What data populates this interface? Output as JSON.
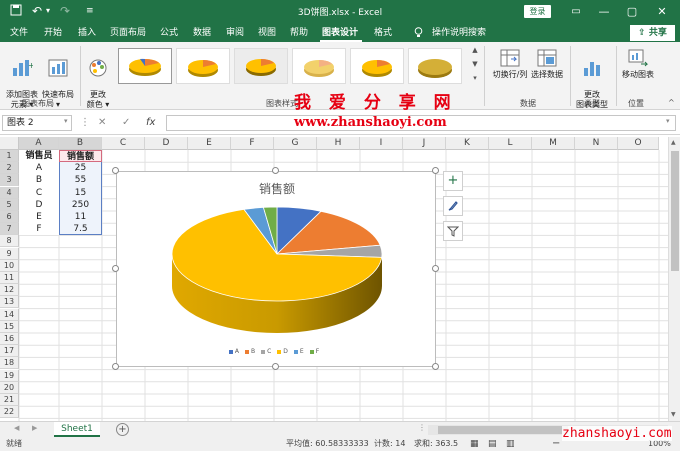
{
  "titlebar": {
    "title": "3D饼图.xlsx  -  Excel",
    "login": "登录",
    "minimize": "—",
    "restore": "▢",
    "close": "✕",
    "save_icon": "save-icon",
    "undo_icon": "undo-icon",
    "redo_icon": "redo-icon"
  },
  "tabs": [
    "文件",
    "开始",
    "插入",
    "页面布局",
    "公式",
    "数据",
    "审阅",
    "视图",
    "帮助",
    "图表设计",
    "格式"
  ],
  "active_tab": "图表设计",
  "tell_me": "操作说明搜索",
  "share": "共享",
  "ribbon": {
    "add_element": "添加图表\n元素 ▾",
    "quick_layout": "快速布局\n▾",
    "group_layout": "图表布局",
    "change_color": "更改\n颜色 ▾",
    "group_style": "图表样式",
    "switch_row_col": "切换行/列",
    "select_data": "选择数据",
    "group_data": "数据",
    "change_type": "更改\n图表类型",
    "group_type": "类型",
    "move_chart": "移动图表",
    "group_location": "位置"
  },
  "formula_bar": {
    "name_box": "图表 2",
    "cancel": "✕",
    "enter": "✓",
    "fx": "fx"
  },
  "columns": [
    "A",
    "B",
    "C",
    "D",
    "E",
    "F",
    "G",
    "H",
    "I",
    "J",
    "K",
    "L",
    "M",
    "N",
    "O"
  ],
  "rows": [
    "1",
    "2",
    "3",
    "4",
    "5",
    "6",
    "7",
    "8",
    "9",
    "10",
    "11",
    "12",
    "13",
    "14",
    "15",
    "16",
    "17",
    "18",
    "19",
    "20",
    "21",
    "22"
  ],
  "table": {
    "headers": [
      "销售员",
      "销售额"
    ],
    "rows": [
      [
        "A",
        "25"
      ],
      [
        "B",
        "55"
      ],
      [
        "C",
        "15"
      ],
      [
        "D",
        "250"
      ],
      [
        "E",
        "11"
      ],
      [
        "F",
        "7.5"
      ]
    ]
  },
  "chart_data": {
    "type": "pie",
    "title": "销售额",
    "categories": [
      "A",
      "B",
      "C",
      "D",
      "E",
      "F"
    ],
    "values": [
      25,
      55,
      15,
      250,
      11,
      7.5
    ],
    "colors": [
      "#4472c4",
      "#ed7d31",
      "#a5a5a5",
      "#ffc000",
      "#5b9bd5",
      "#70ad47"
    ],
    "legend": "bottom"
  },
  "side_buttons": {
    "elements": "+",
    "styles": "brush-icon",
    "filters": "filter-icon"
  },
  "sheet_tabs": [
    "Sheet1"
  ],
  "add_sheet": "+",
  "status": {
    "ready": "就绪",
    "average": "平均值: 60.58333333",
    "count": "计数: 14",
    "sum": "求和: 363.5",
    "zoom": "100%"
  },
  "watermark": {
    "cn": "我 爱 分 享 网",
    "url": "www.zhanshaoyi.com",
    "url2": "zhanshaoyi.com"
  }
}
